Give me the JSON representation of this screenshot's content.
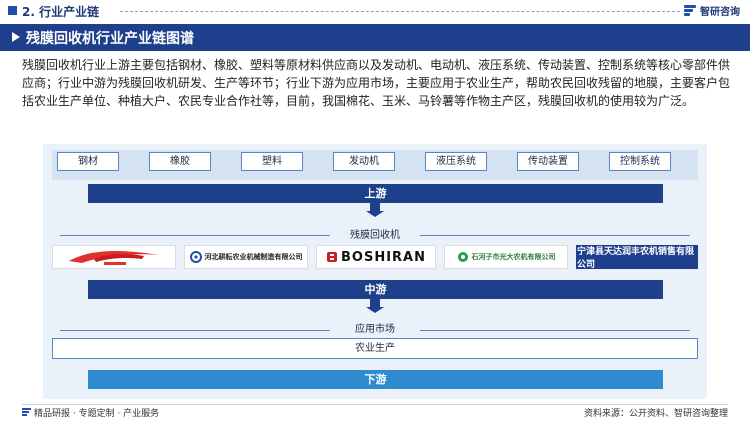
{
  "header": {
    "section": "2. 行业产业链",
    "brand": "智研咨询"
  },
  "title": "残膜回收机行业产业链图谱",
  "intro": "残膜回收机行业上游主要包括钢材、橡胶、塑料等原材料供应商以及发动机、电动机、液压系统、传动装置、控制系统等核心零部件供应商；行业中游为残膜回收机研发、生产等环节；行业下游为应用市场，主要应用于农业生产，帮助农民回收残留的地膜，主要客户包括农业生产单位、种植大户、农民专业合作社等，目前，我国棉花、玉米、马铃薯等作物主产区，残膜回收机的使用较为广泛。",
  "upstream": {
    "materials": [
      "钢材",
      "橡胶",
      "塑料",
      "发动机",
      "液压系统",
      "传动装置",
      "控制系统"
    ],
    "band": "上游"
  },
  "midstream": {
    "label": "残膜回收机",
    "companies": [
      "河北耕耘农业机械制造有限公司",
      "BOSHIRAN",
      "石河子市光大农机有限公司",
      "宁津县天达润丰农机销售有限公司"
    ],
    "band": "中游"
  },
  "downstream": {
    "label": "应用市场",
    "application": "农业生产",
    "band": "下游"
  },
  "footer": {
    "left": "精品研报 · 专题定制 · 产业服务",
    "right": "资料来源：公开资料、智研咨询整理"
  },
  "colors": {
    "primary": "#1e3f8c",
    "accent": "#2f8bd0",
    "panel": "#eaf1f9"
  }
}
